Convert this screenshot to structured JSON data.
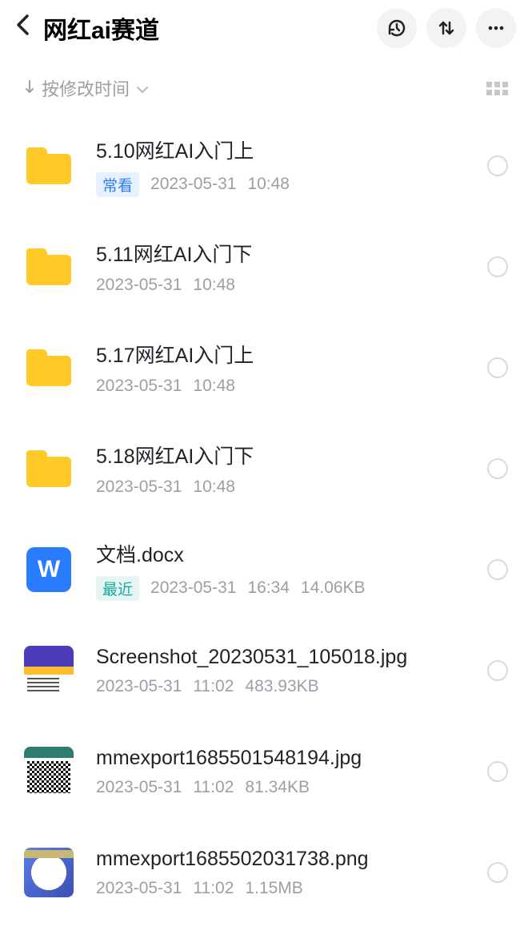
{
  "header": {
    "title": "网红ai赛道"
  },
  "sort": {
    "label": "按修改时间"
  },
  "items": [
    {
      "type": "folder",
      "name": "5.10网红AI入门上",
      "badge": "常看",
      "badgeClass": "blue",
      "date": "2023-05-31",
      "time": "10:48",
      "size": ""
    },
    {
      "type": "folder",
      "name": "5.11网红AI入门下",
      "badge": "",
      "badgeClass": "",
      "date": "2023-05-31",
      "time": "10:48",
      "size": ""
    },
    {
      "type": "folder",
      "name": "5.17网红AI入门上",
      "badge": "",
      "badgeClass": "",
      "date": "2023-05-31",
      "time": "10:48",
      "size": ""
    },
    {
      "type": "folder",
      "name": "5.18网红AI入门下",
      "badge": "",
      "badgeClass": "",
      "date": "2023-05-31",
      "time": "10:48",
      "size": ""
    },
    {
      "type": "doc",
      "name": "文档.docx",
      "badge": "最近",
      "badgeClass": "cyan",
      "date": "2023-05-31",
      "time": "16:34",
      "size": "14.06KB"
    },
    {
      "type": "img1",
      "name": "Screenshot_20230531_105018.jpg",
      "badge": "",
      "badgeClass": "",
      "date": "2023-05-31",
      "time": "11:02",
      "size": "483.93KB"
    },
    {
      "type": "img2",
      "name": "mmexport1685501548194.jpg",
      "badge": "",
      "badgeClass": "",
      "date": "2023-05-31",
      "time": "11:02",
      "size": "81.34KB"
    },
    {
      "type": "img3",
      "name": "mmexport1685502031738.png",
      "badge": "",
      "badgeClass": "",
      "date": "2023-05-31",
      "time": "11:02",
      "size": "1.15MB"
    }
  ]
}
